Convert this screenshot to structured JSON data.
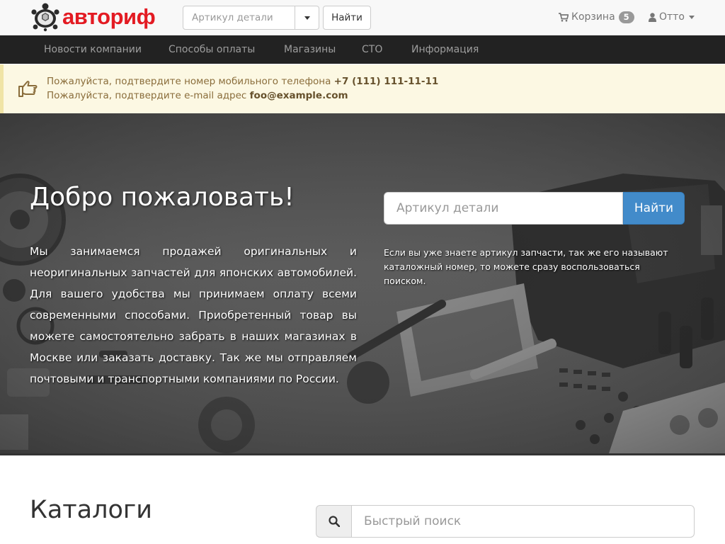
{
  "header": {
    "logo_text": "авториф",
    "search_placeholder": "Артикул детали",
    "find_label": "Найти",
    "cart_label": "Корзина",
    "cart_count": "5",
    "user_name": "Отто"
  },
  "nav": {
    "items": [
      "Новости компании",
      "Способы оплаты",
      "Магазины",
      "СТО",
      "Информация"
    ]
  },
  "alert": {
    "phone_prefix": "Пожалуйста, подтвердите номер мобильного телефона",
    "phone": "+7 (111) 111-11-11",
    "email_prefix": "Пожалуйста, подтвердите e-mail адрес",
    "email": "foo@example.com"
  },
  "hero": {
    "title": "Добро пожаловать!",
    "text": "Мы занимаемся продажей оригинальных и неоригинальных запчастей для японских автомобилей. Для вашего удобства мы принимаем оплату всеми современными способами. Приобретенный товар вы можете самостоятельно забрать в наших магазинах в Москве или заказать доставку. Так же мы отправляем почтовыми и транспортными компаниями по России.",
    "search_placeholder": "Артикул детали",
    "search_button": "Найти",
    "hint": "Если вы уже знаете артикул запчасти, так же его называют каталожный номер, то можете сразу воспользоваться поиском."
  },
  "catalogs": {
    "title": "Каталоги",
    "quick_search_placeholder": "Быстрый поиск"
  },
  "colors": {
    "brand_red": "#e31b23",
    "primary_blue": "#428bca",
    "navbar_dark": "#222222",
    "alert_bg": "#fcf8e3"
  }
}
